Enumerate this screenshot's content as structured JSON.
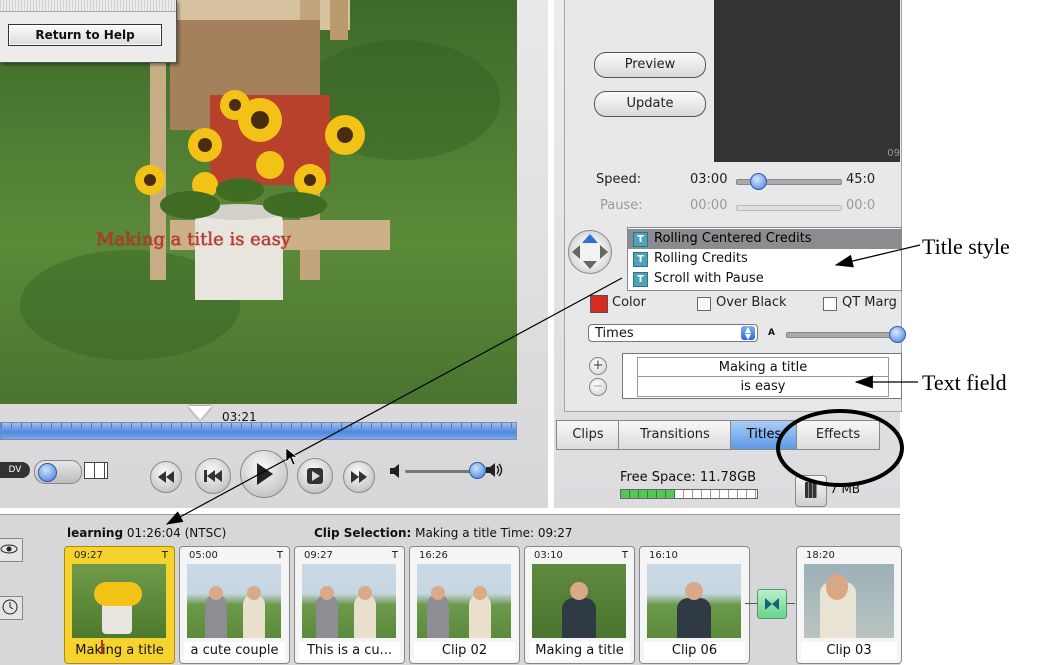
{
  "help_panel": {
    "return_label": "Return to Help"
  },
  "monitor": {
    "caption": "Making a title   is easy",
    "playhead_time": "03:21",
    "dv_label": "DV"
  },
  "titles_panel": {
    "preview_label": "Preview",
    "update_label": "Update",
    "preview_timecode": "09",
    "speed_label": "Speed:",
    "speed_value": "03:00",
    "speed_max": "45:0",
    "pause_label": "Pause:",
    "pause_value": "00:00",
    "pause_max": "00:0",
    "title_styles": [
      {
        "label": "Rolling Centered Credits",
        "selected": true
      },
      {
        "label": "Rolling Credits",
        "selected": false
      },
      {
        "label": "Scroll with Pause",
        "selected": false
      }
    ],
    "color_label": "Color",
    "color_swatch": "#d62b1f",
    "over_black_label": "Over Black",
    "qt_margins_label": "QT Marg",
    "font_name": "Times",
    "size_small_label": "A",
    "text_line_1": "Making a title",
    "text_line_2": "is easy"
  },
  "tabs": [
    "Clips",
    "Transitions",
    "Titles",
    "Effects"
  ],
  "active_tab": "Titles",
  "status": {
    "free_space": "Free Space: 11.78GB",
    "free_space_fraction": 0.4,
    "trash_size": "7 MB"
  },
  "clip_viewer": {
    "project_name": "learning",
    "project_time": "01:26:04",
    "format": "(NTSC)",
    "selection_label": "Clip Selection:",
    "selection_value": "Making a title",
    "time_label": "Time: 09:27",
    "clips": [
      {
        "duration": "09:27",
        "flag": "T",
        "name": "Making a title",
        "selected": true
      },
      {
        "duration": "05:00",
        "flag": "T",
        "name": "a cute couple",
        "selected": false
      },
      {
        "duration": "09:27",
        "flag": "T",
        "name": "This is a cu...",
        "selected": false
      },
      {
        "duration": "16:26",
        "flag": "",
        "name": "Clip 02",
        "selected": false
      },
      {
        "duration": "03:10",
        "flag": "T",
        "name": "Making a title",
        "selected": false
      },
      {
        "duration": "16:10",
        "flag": "",
        "name": "Clip 06",
        "selected": false
      },
      {
        "duration": "18:20",
        "flag": "",
        "name": "Clip 03",
        "selected": false
      }
    ]
  },
  "annotations": {
    "title_style": "Title style",
    "text_field": "Text field"
  },
  "colors": {
    "accent_blue": "#4f88dd",
    "selected_clip": "#f6d22e",
    "title_red": "#c8342a"
  }
}
